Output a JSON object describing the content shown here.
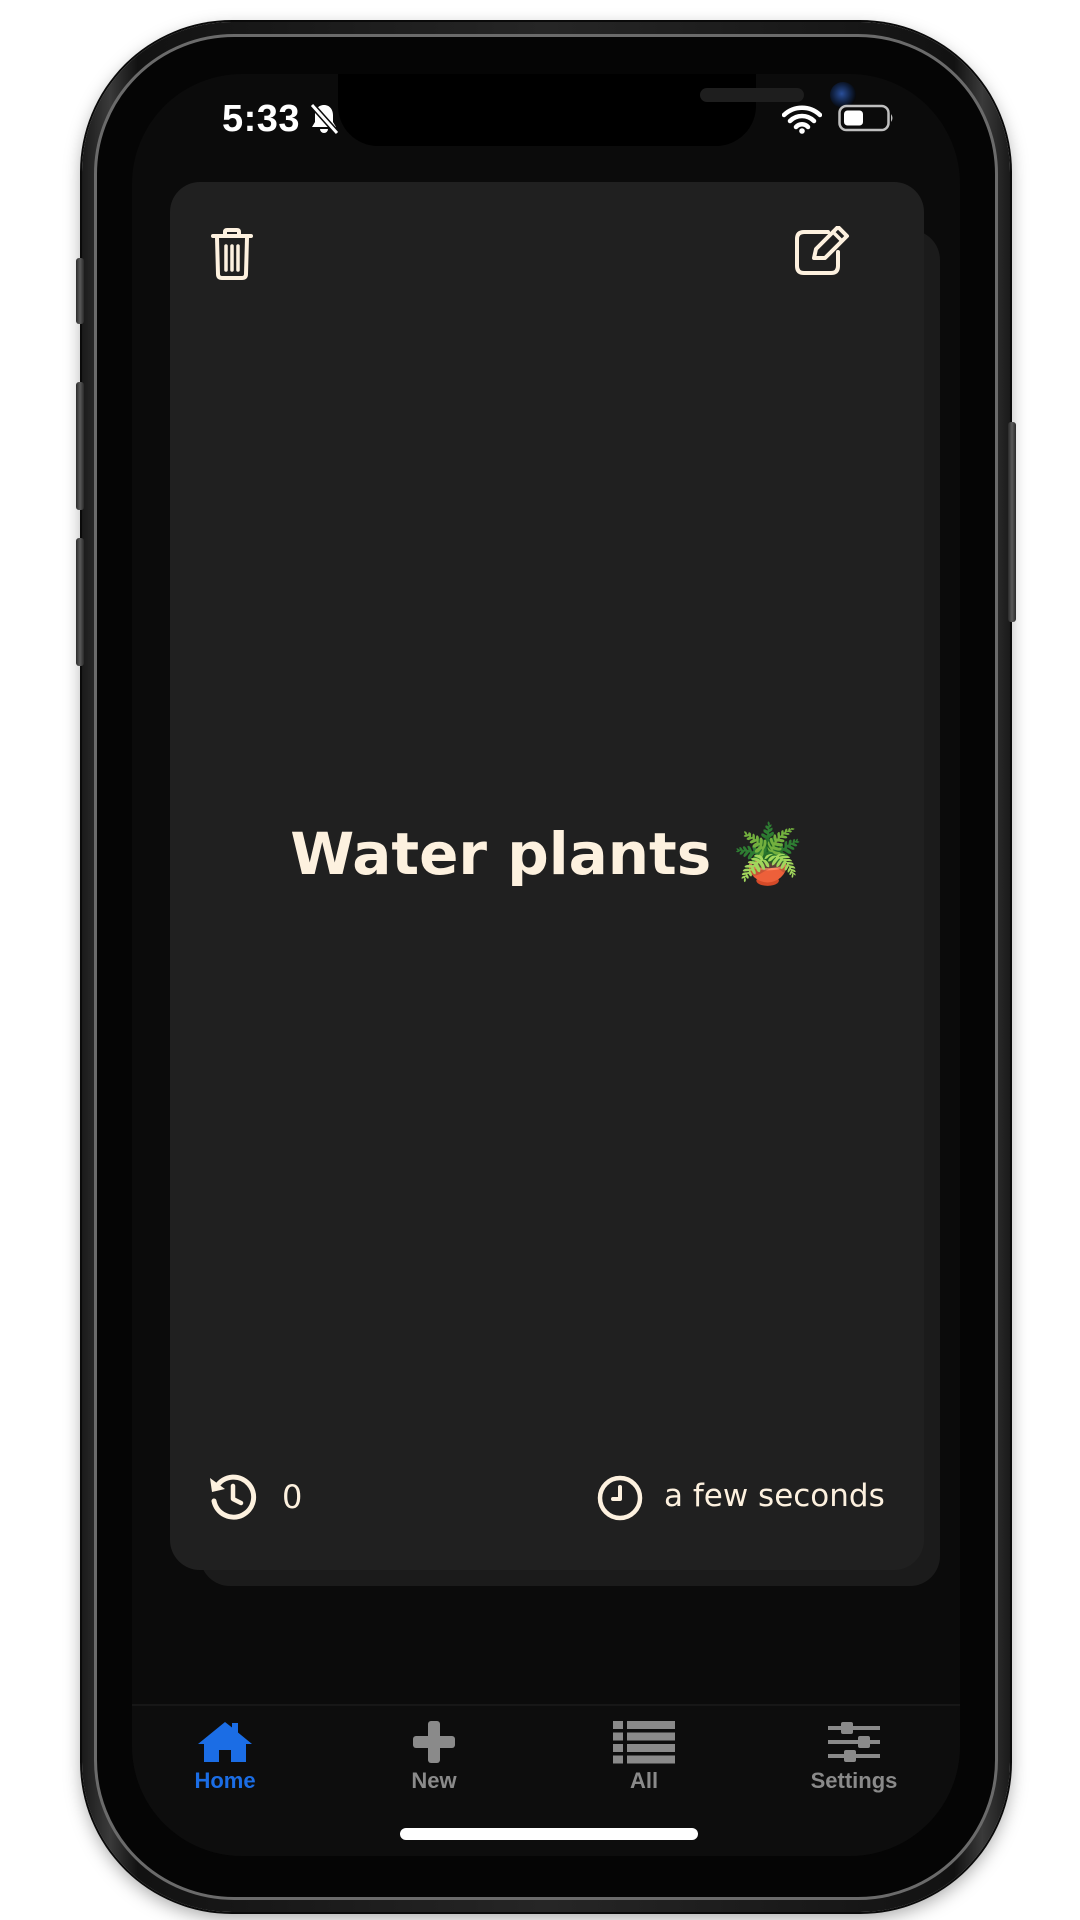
{
  "status_bar": {
    "time": "5:33",
    "icons": [
      "bell-slash-icon",
      "wifi-icon",
      "battery-icon"
    ]
  },
  "card": {
    "title": "Water plants 🪴",
    "streak_count": "0",
    "elapsed": "a few seconds",
    "icons": [
      "trash-icon",
      "edit-icon",
      "history-icon",
      "clock-icon"
    ]
  },
  "tabbar": {
    "tabs": [
      {
        "label": "Home",
        "icon": "home-icon",
        "active": true
      },
      {
        "label": "New",
        "icon": "plus-icon",
        "active": false
      },
      {
        "label": "All",
        "icon": "list-icon",
        "active": false
      },
      {
        "label": "Settings",
        "icon": "sliders-icon",
        "active": false
      }
    ]
  },
  "colors": {
    "accent": "#1b6de5",
    "text": "#fdf1df",
    "card_background": "#202020",
    "screen_background": "#0b0b0b",
    "inactive_tab": "#8a8a8a"
  }
}
